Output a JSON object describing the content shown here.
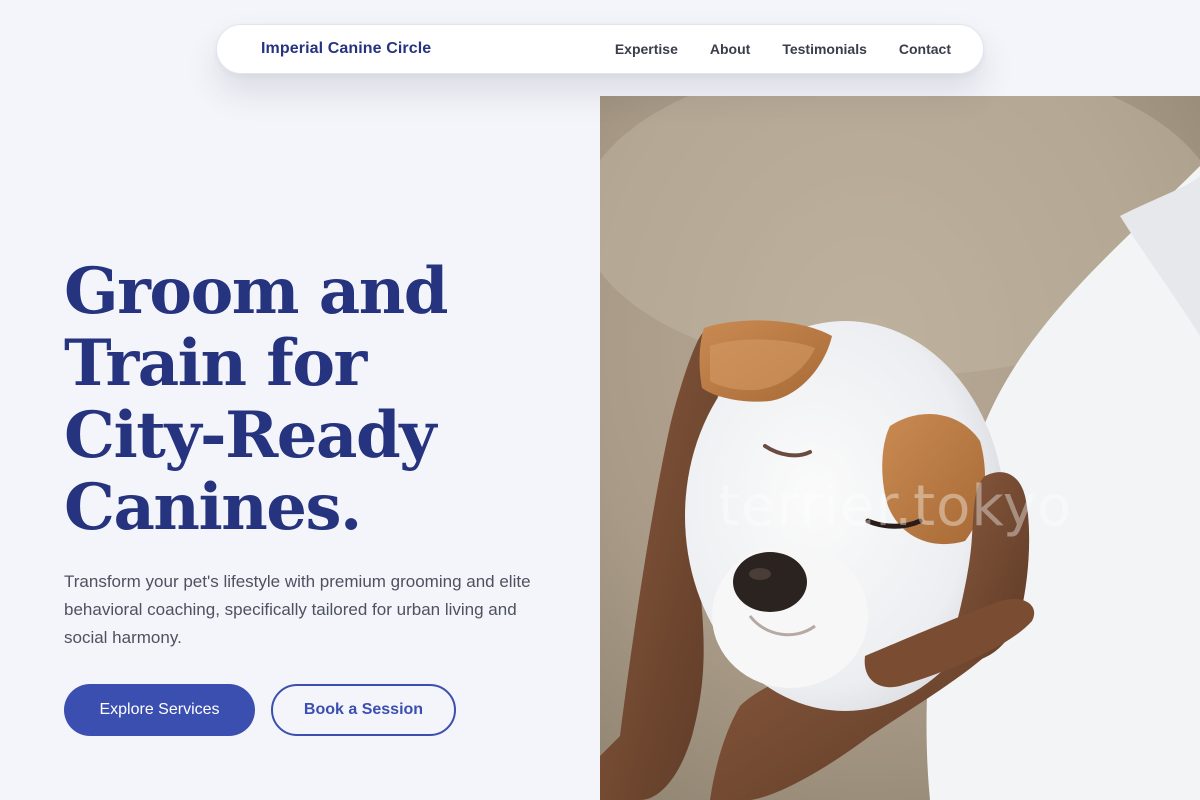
{
  "nav": {
    "brand": "Imperial Canine Circle",
    "links": [
      "Expertise",
      "About",
      "Testimonials",
      "Contact"
    ]
  },
  "hero": {
    "title_lines": [
      "Groom and",
      "Train for",
      "City-Ready",
      "Canines."
    ],
    "subtitle": "Transform your pet's lifestyle with premium grooming and elite behavioral coaching, specifically tailored for urban living and social harmony.",
    "primary_button": "Explore Services",
    "secondary_button": "Book a Session"
  },
  "image": {
    "subject": "puppy-held-in-hands",
    "watermark": "terrier.tokyo"
  },
  "colors": {
    "background": "#f4f5fa",
    "brand": "#26347f",
    "accent": "#3b4fb0",
    "text_muted": "#4e5260"
  }
}
